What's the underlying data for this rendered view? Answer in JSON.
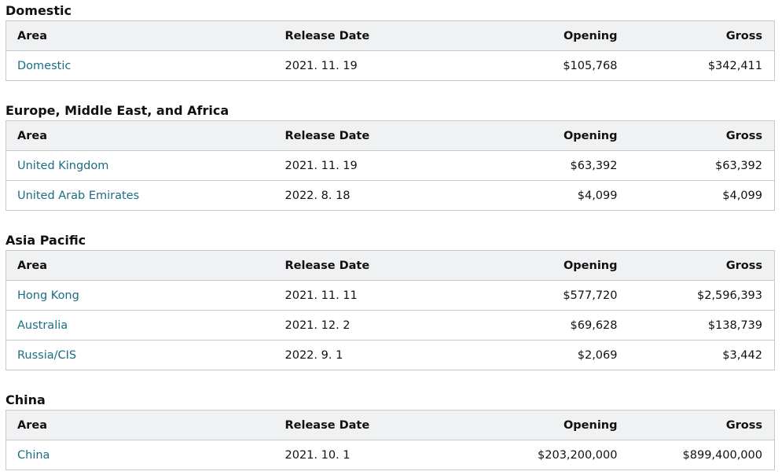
{
  "columns": {
    "area": "Area",
    "release_date": "Release Date",
    "opening": "Opening",
    "gross": "Gross"
  },
  "link_color": "#1a6e84",
  "sections": [
    {
      "title": "Domestic",
      "rows": [
        {
          "area": "Domestic",
          "release_date": "2021. 11. 19",
          "opening": "$105,768",
          "gross": "$342,411"
        }
      ]
    },
    {
      "title": "Europe, Middle East, and Africa",
      "rows": [
        {
          "area": "United Kingdom",
          "release_date": "2021. 11. 19",
          "opening": "$63,392",
          "gross": "$63,392"
        },
        {
          "area": "United Arab Emirates",
          "release_date": "2022. 8. 18",
          "opening": "$4,099",
          "gross": "$4,099"
        }
      ]
    },
    {
      "title": "Asia Pacific",
      "rows": [
        {
          "area": "Hong Kong",
          "release_date": "2021. 11. 11",
          "opening": "$577,720",
          "gross": "$2,596,393"
        },
        {
          "area": "Australia",
          "release_date": "2021. 12. 2",
          "opening": "$69,628",
          "gross": "$138,739"
        },
        {
          "area": "Russia/CIS",
          "release_date": "2022. 9. 1",
          "opening": "$2,069",
          "gross": "$3,442"
        }
      ]
    },
    {
      "title": "China",
      "rows": [
        {
          "area": "China",
          "release_date": "2021. 10. 1",
          "opening": "$203,200,000",
          "gross": "$899,400,000"
        }
      ]
    }
  ]
}
